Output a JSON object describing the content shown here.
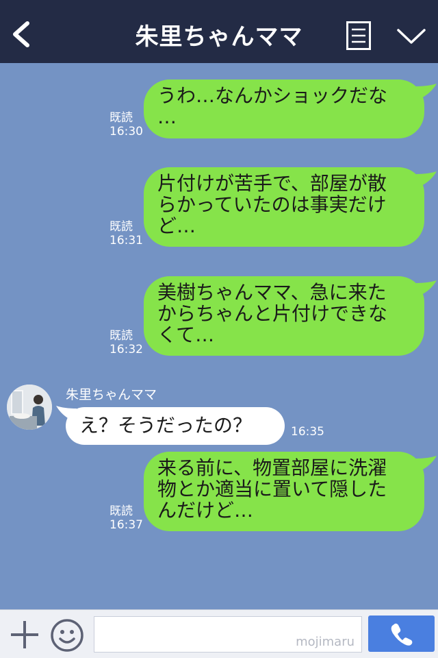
{
  "header": {
    "title": "朱里ちゃんママ",
    "back_icon": "chevron-left-icon",
    "menu_icon": "list-icon",
    "toggle_icon": "chevron-down-icon",
    "background": "#232b45"
  },
  "chat": {
    "background": "#7493c4",
    "outgoing_color": "#86e34a",
    "messages": [
      {
        "text_lines": [
          "うわ…なんかショックだな",
          "…"
        ],
        "read": "既読",
        "time": "16:30"
      },
      {
        "text_lines": [
          "片付けが苦手で、部屋が散",
          "らかっていたのは事実だけ",
          "ど…"
        ],
        "read": "既読",
        "time": "16:31"
      },
      {
        "text_lines": [
          "美樹ちゃんママ、急に来た",
          "からちゃんと片付けできな",
          "くて…"
        ],
        "read": "既読",
        "time": "16:32"
      },
      {
        "text_lines": [
          "来る前に、物置部屋に洗濯",
          "物とか適当に置いて隠した",
          "んだけど…"
        ],
        "read": "既読",
        "time": "16:37"
      }
    ],
    "incoming": {
      "sender": "朱里ちゃんママ",
      "text": "え？そうだったの？",
      "time": "16:35"
    }
  },
  "footer": {
    "plus_icon": "plus-icon",
    "emoji_icon": "smile-icon",
    "input_value": "",
    "watermark": "mojimaru",
    "call_icon": "phone-icon",
    "call_color": "#4a7fe0"
  }
}
